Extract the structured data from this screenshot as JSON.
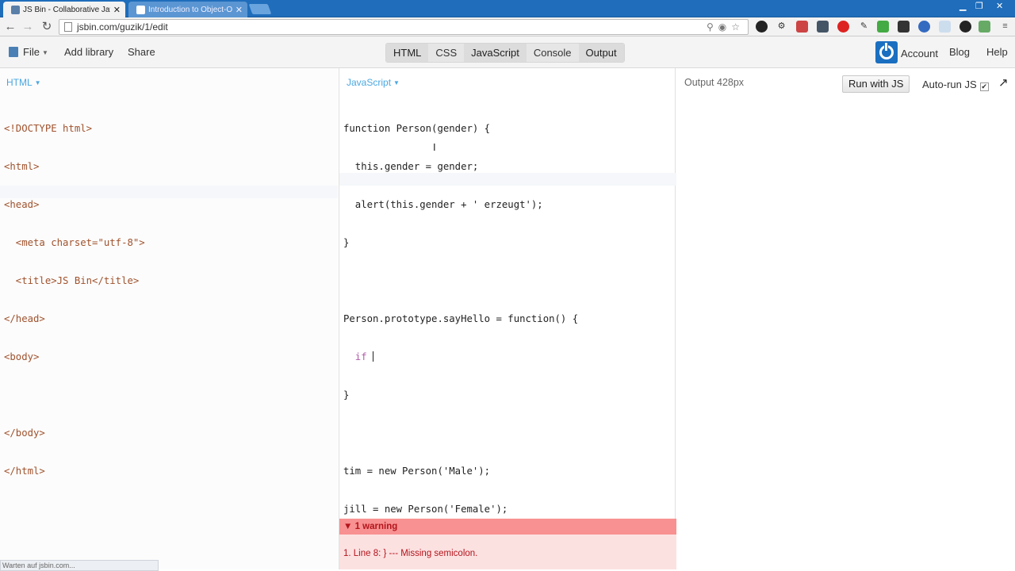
{
  "browser": {
    "tabs": [
      {
        "title": "JS Bin - Collaborative Java",
        "active": true
      },
      {
        "title": "Introduction to Object-O",
        "active": false
      }
    ],
    "url": "jsbin.com/guzik/1/edit",
    "status_text": "Warten auf jsbin.com..."
  },
  "toolbar": {
    "file_label": "File",
    "add_library_label": "Add library",
    "share_label": "Share",
    "panels": [
      "HTML",
      "CSS",
      "JavaScript",
      "Console",
      "Output"
    ],
    "account_label": "Account",
    "blog_label": "Blog",
    "help_label": "Help"
  },
  "html_panel": {
    "label": "HTML",
    "lines": [
      "<!DOCTYPE html>",
      "<html>",
      "<head>",
      "  <meta charset=\"utf-8\">",
      "  <title>JS Bin</title>",
      "</head>",
      "<body>",
      "",
      "</body>",
      "</html>"
    ]
  },
  "js_panel": {
    "label": "JavaScript",
    "lines": [
      "function Person(gender) {",
      "  this.gender = gender;",
      "  alert(this.gender + ' erzeugt');",
      "}",
      "",
      "Person.prototype.sayHello = function() {",
      "  if ",
      "}",
      "",
      "tim = new Person('Male');",
      "jill = new Person('Female');"
    ],
    "warning_header": "1 warning",
    "warning_text": "1.  Line 8: } --- Missing semicolon."
  },
  "output_panel": {
    "label": "Output 428px",
    "run_button": "Run with JS",
    "autorun_label": "Auto-run JS",
    "autorun_checked": true
  },
  "colors": {
    "tab_strip": "#1f6dbb",
    "panel_label": "#4aa7e0",
    "warning_bar": "#f89191",
    "warning_text": "#b3141b",
    "account_logo": "#1a6fc0"
  }
}
